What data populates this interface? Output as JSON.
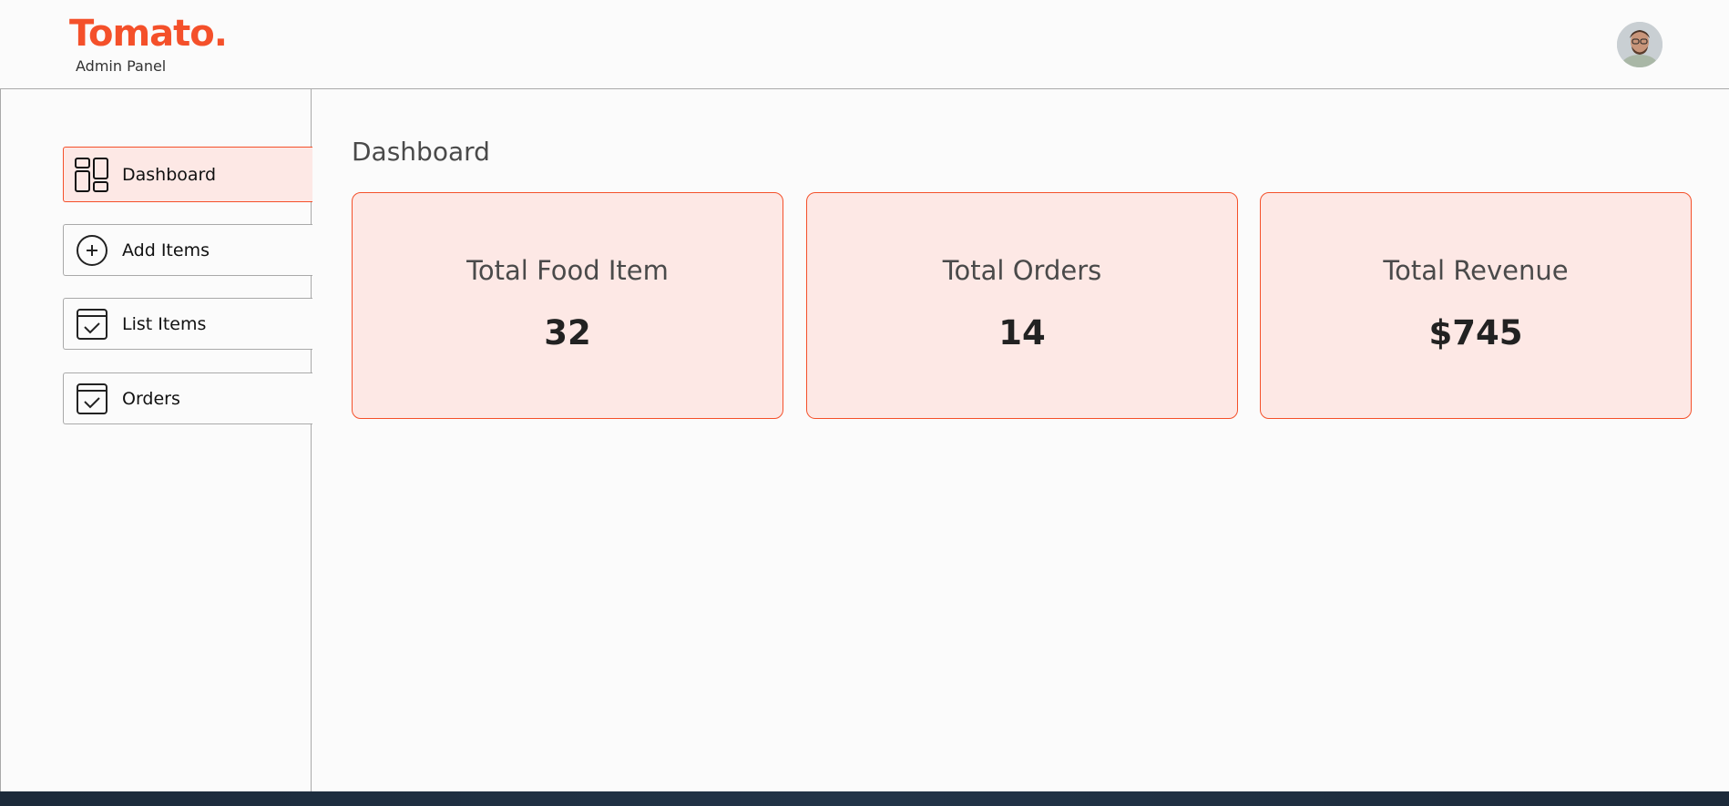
{
  "header": {
    "logo": "Tomato.",
    "subtitle": "Admin Panel",
    "avatar_icon": "user-avatar-icon"
  },
  "sidebar": {
    "items": [
      {
        "label": "Dashboard",
        "icon": "dashboard-icon",
        "active": true
      },
      {
        "label": "Add Items",
        "icon": "add-circle-icon",
        "active": false
      },
      {
        "label": "List Items",
        "icon": "checklist-icon",
        "active": false
      },
      {
        "label": "Orders",
        "icon": "orders-icon",
        "active": false
      }
    ]
  },
  "main": {
    "title": "Dashboard",
    "cards": [
      {
        "title": "Total Food Item",
        "value": "32"
      },
      {
        "title": "Total Orders",
        "value": "14"
      },
      {
        "title": "Total Revenue",
        "value": "$745"
      }
    ]
  },
  "colors": {
    "accent": "#f4502a",
    "card_bg": "#fde8e5",
    "border": "#a9a9a9"
  }
}
